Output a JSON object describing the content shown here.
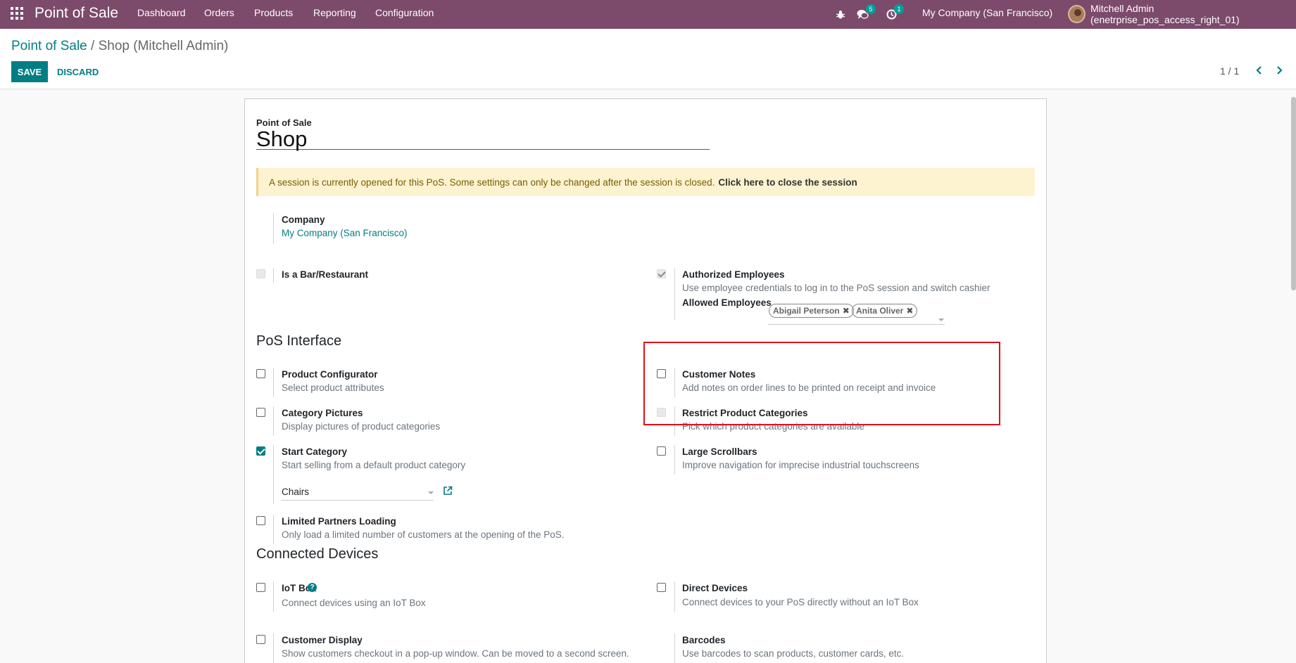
{
  "navbar": {
    "app_name": "Point of Sale",
    "menu": [
      "Dashboard",
      "Orders",
      "Products",
      "Reporting",
      "Configuration"
    ],
    "messages_count": "5",
    "activities_count": "1",
    "company": "My Company (San Francisco)",
    "user": "Mitchell Admin (enetrprise_pos_access_right_01)",
    "brand_color": "#7c4a6b"
  },
  "control_panel": {
    "breadcrumb_parent": "Point of Sale",
    "breadcrumb_separator": "/",
    "breadcrumb_current": "Shop (Mitchell Admin)",
    "save_label": "SAVE",
    "discard_label": "DISCARD",
    "pager": "1 / 1"
  },
  "form": {
    "pos_label": "Point of Sale",
    "name": "Shop",
    "alert_text": "A session is currently opened for this PoS. Some settings can only be changed after the session is closed.",
    "alert_action": "Click here to close the session",
    "company_label": "Company",
    "company_value": "My Company (San Francisco)",
    "bar_restaurant": {
      "label": "Is a Bar/Restaurant",
      "checked": false,
      "disabled": true
    },
    "authorized_employees": {
      "label": "Authorized Employees",
      "description": "Use employee credentials to log in to the PoS session and switch cashier",
      "checked": true,
      "disabled": true,
      "allowed_label": "Allowed Employees",
      "allowed": [
        "Abigail Peterson",
        "Anita Oliver"
      ]
    },
    "pos_interface_title": "PoS Interface",
    "product_configurator": {
      "label": "Product Configurator",
      "description": "Select product attributes",
      "checked": false
    },
    "customer_notes": {
      "label": "Customer Notes",
      "description": "Add notes on order lines to be printed on receipt and invoice",
      "checked": false
    },
    "category_pictures": {
      "label": "Category Pictures",
      "description": "Display pictures of product categories",
      "checked": false
    },
    "restrict_categories": {
      "label": "Restrict Product Categories",
      "description": "Pick which product categories are available",
      "checked": false,
      "disabled": true
    },
    "start_category": {
      "label": "Start Category",
      "description": "Start selling from a default product category",
      "checked": true,
      "value": "Chairs"
    },
    "large_scrollbars": {
      "label": "Large Scrollbars",
      "description": "Improve navigation for imprecise industrial touchscreens",
      "checked": false
    },
    "limited_partners": {
      "label": "Limited Partners Loading",
      "description": "Only load a limited number of customers at the opening of the PoS.",
      "checked": false
    },
    "connected_devices_title": "Connected Devices",
    "iot_box": {
      "label": "IoT Box",
      "description": "Connect devices using an IoT Box",
      "checked": false,
      "help": "?"
    },
    "direct_devices": {
      "label": "Direct Devices",
      "description": "Connect devices to your PoS directly without an IoT Box",
      "checked": false
    },
    "customer_display": {
      "label": "Customer Display",
      "description": "Show customers checkout in a pop-up window. Can be moved to a second screen.",
      "checked": false
    },
    "barcodes": {
      "label": "Barcodes",
      "description": "Use barcodes to scan products, customer cards, etc."
    }
  },
  "colors": {
    "accent": "#017e84",
    "highlight_box": "#e10f1a",
    "alert_bg": "#fdf3d0"
  }
}
